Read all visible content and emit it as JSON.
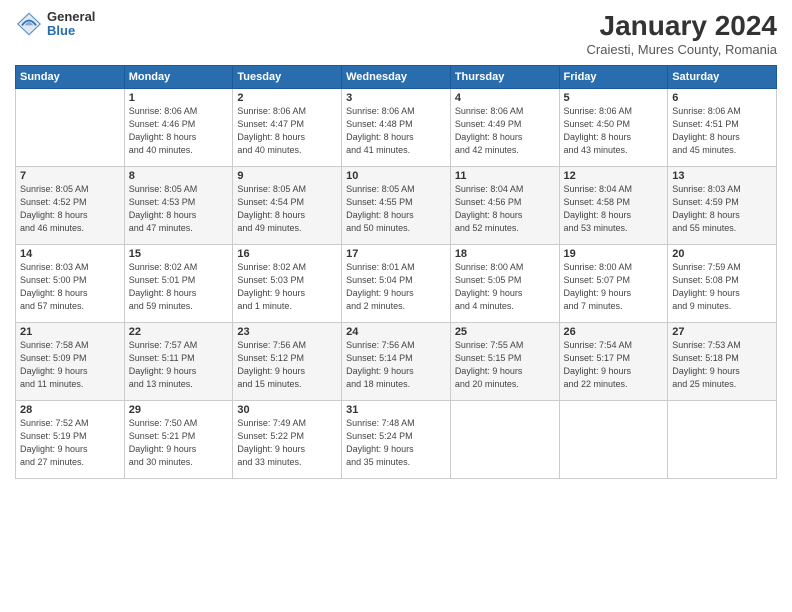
{
  "header": {
    "logo_general": "General",
    "logo_blue": "Blue",
    "title": "January 2024",
    "subtitle": "Craiesti, Mures County, Romania"
  },
  "days_of_week": [
    "Sunday",
    "Monday",
    "Tuesday",
    "Wednesday",
    "Thursday",
    "Friday",
    "Saturday"
  ],
  "weeks": [
    [
      {
        "day": "",
        "info": ""
      },
      {
        "day": "1",
        "info": "Sunrise: 8:06 AM\nSunset: 4:46 PM\nDaylight: 8 hours\nand 40 minutes."
      },
      {
        "day": "2",
        "info": "Sunrise: 8:06 AM\nSunset: 4:47 PM\nDaylight: 8 hours\nand 40 minutes."
      },
      {
        "day": "3",
        "info": "Sunrise: 8:06 AM\nSunset: 4:48 PM\nDaylight: 8 hours\nand 41 minutes."
      },
      {
        "day": "4",
        "info": "Sunrise: 8:06 AM\nSunset: 4:49 PM\nDaylight: 8 hours\nand 42 minutes."
      },
      {
        "day": "5",
        "info": "Sunrise: 8:06 AM\nSunset: 4:50 PM\nDaylight: 8 hours\nand 43 minutes."
      },
      {
        "day": "6",
        "info": "Sunrise: 8:06 AM\nSunset: 4:51 PM\nDaylight: 8 hours\nand 45 minutes."
      }
    ],
    [
      {
        "day": "7",
        "info": "Sunrise: 8:05 AM\nSunset: 4:52 PM\nDaylight: 8 hours\nand 46 minutes."
      },
      {
        "day": "8",
        "info": "Sunrise: 8:05 AM\nSunset: 4:53 PM\nDaylight: 8 hours\nand 47 minutes."
      },
      {
        "day": "9",
        "info": "Sunrise: 8:05 AM\nSunset: 4:54 PM\nDaylight: 8 hours\nand 49 minutes."
      },
      {
        "day": "10",
        "info": "Sunrise: 8:05 AM\nSunset: 4:55 PM\nDaylight: 8 hours\nand 50 minutes."
      },
      {
        "day": "11",
        "info": "Sunrise: 8:04 AM\nSunset: 4:56 PM\nDaylight: 8 hours\nand 52 minutes."
      },
      {
        "day": "12",
        "info": "Sunrise: 8:04 AM\nSunset: 4:58 PM\nDaylight: 8 hours\nand 53 minutes."
      },
      {
        "day": "13",
        "info": "Sunrise: 8:03 AM\nSunset: 4:59 PM\nDaylight: 8 hours\nand 55 minutes."
      }
    ],
    [
      {
        "day": "14",
        "info": "Sunrise: 8:03 AM\nSunset: 5:00 PM\nDaylight: 8 hours\nand 57 minutes."
      },
      {
        "day": "15",
        "info": "Sunrise: 8:02 AM\nSunset: 5:01 PM\nDaylight: 8 hours\nand 59 minutes."
      },
      {
        "day": "16",
        "info": "Sunrise: 8:02 AM\nSunset: 5:03 PM\nDaylight: 9 hours\nand 1 minute."
      },
      {
        "day": "17",
        "info": "Sunrise: 8:01 AM\nSunset: 5:04 PM\nDaylight: 9 hours\nand 2 minutes."
      },
      {
        "day": "18",
        "info": "Sunrise: 8:00 AM\nSunset: 5:05 PM\nDaylight: 9 hours\nand 4 minutes."
      },
      {
        "day": "19",
        "info": "Sunrise: 8:00 AM\nSunset: 5:07 PM\nDaylight: 9 hours\nand 7 minutes."
      },
      {
        "day": "20",
        "info": "Sunrise: 7:59 AM\nSunset: 5:08 PM\nDaylight: 9 hours\nand 9 minutes."
      }
    ],
    [
      {
        "day": "21",
        "info": "Sunrise: 7:58 AM\nSunset: 5:09 PM\nDaylight: 9 hours\nand 11 minutes."
      },
      {
        "day": "22",
        "info": "Sunrise: 7:57 AM\nSunset: 5:11 PM\nDaylight: 9 hours\nand 13 minutes."
      },
      {
        "day": "23",
        "info": "Sunrise: 7:56 AM\nSunset: 5:12 PM\nDaylight: 9 hours\nand 15 minutes."
      },
      {
        "day": "24",
        "info": "Sunrise: 7:56 AM\nSunset: 5:14 PM\nDaylight: 9 hours\nand 18 minutes."
      },
      {
        "day": "25",
        "info": "Sunrise: 7:55 AM\nSunset: 5:15 PM\nDaylight: 9 hours\nand 20 minutes."
      },
      {
        "day": "26",
        "info": "Sunrise: 7:54 AM\nSunset: 5:17 PM\nDaylight: 9 hours\nand 22 minutes."
      },
      {
        "day": "27",
        "info": "Sunrise: 7:53 AM\nSunset: 5:18 PM\nDaylight: 9 hours\nand 25 minutes."
      }
    ],
    [
      {
        "day": "28",
        "info": "Sunrise: 7:52 AM\nSunset: 5:19 PM\nDaylight: 9 hours\nand 27 minutes."
      },
      {
        "day": "29",
        "info": "Sunrise: 7:50 AM\nSunset: 5:21 PM\nDaylight: 9 hours\nand 30 minutes."
      },
      {
        "day": "30",
        "info": "Sunrise: 7:49 AM\nSunset: 5:22 PM\nDaylight: 9 hours\nand 33 minutes."
      },
      {
        "day": "31",
        "info": "Sunrise: 7:48 AM\nSunset: 5:24 PM\nDaylight: 9 hours\nand 35 minutes."
      },
      {
        "day": "",
        "info": ""
      },
      {
        "day": "",
        "info": ""
      },
      {
        "day": "",
        "info": ""
      }
    ]
  ]
}
